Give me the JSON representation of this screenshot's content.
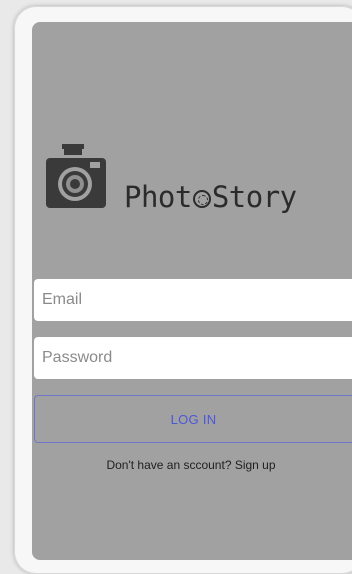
{
  "app": {
    "name_part1": "Phot",
    "name_part2": "Story"
  },
  "form": {
    "email_placeholder": "Email",
    "email_value": "",
    "password_placeholder": "Password",
    "password_value": "",
    "login_label": "LOG IN",
    "signup_text": "Don't have an sccount? Sign up"
  },
  "icons": {
    "logo": "camera-icon",
    "brand_o": "aperture-icon"
  },
  "colors": {
    "screen_bg": "#a1a1a1",
    "button_text": "#4b57d9",
    "button_border": "#6f78c8",
    "logo": "#3a3a3a"
  }
}
